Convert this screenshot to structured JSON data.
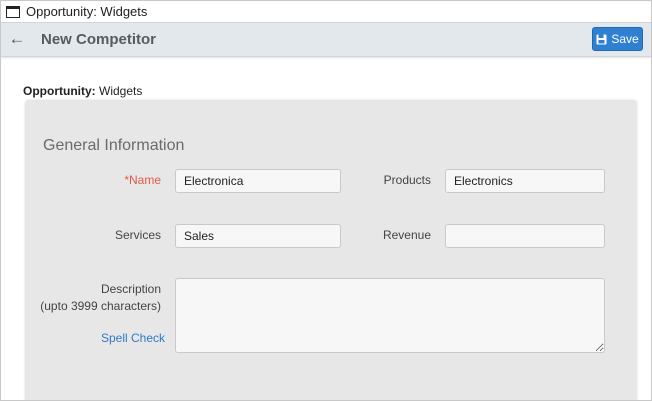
{
  "window": {
    "title": "Opportunity: Widgets"
  },
  "header": {
    "title": "New Competitor",
    "save_label": "Save",
    "back_icon": "arrow-left-icon",
    "save_icon": "floppy-disk-icon",
    "accent_color": "#2f80d1"
  },
  "context": {
    "opportunity_label": "Opportunity:",
    "opportunity_value": "Widgets"
  },
  "form": {
    "section_title": "General Information",
    "name": {
      "label": "*Name",
      "value": "Electronica",
      "required_color": "#e05a48"
    },
    "products": {
      "label": "Products",
      "value": "Electronics"
    },
    "services": {
      "label": "Services",
      "value": "Sales"
    },
    "revenue": {
      "label": "Revenue",
      "value": ""
    },
    "description": {
      "label": "Description",
      "hint": "(upto 3999 characters)",
      "value": "",
      "spell_check_label": "Spell Check"
    }
  }
}
